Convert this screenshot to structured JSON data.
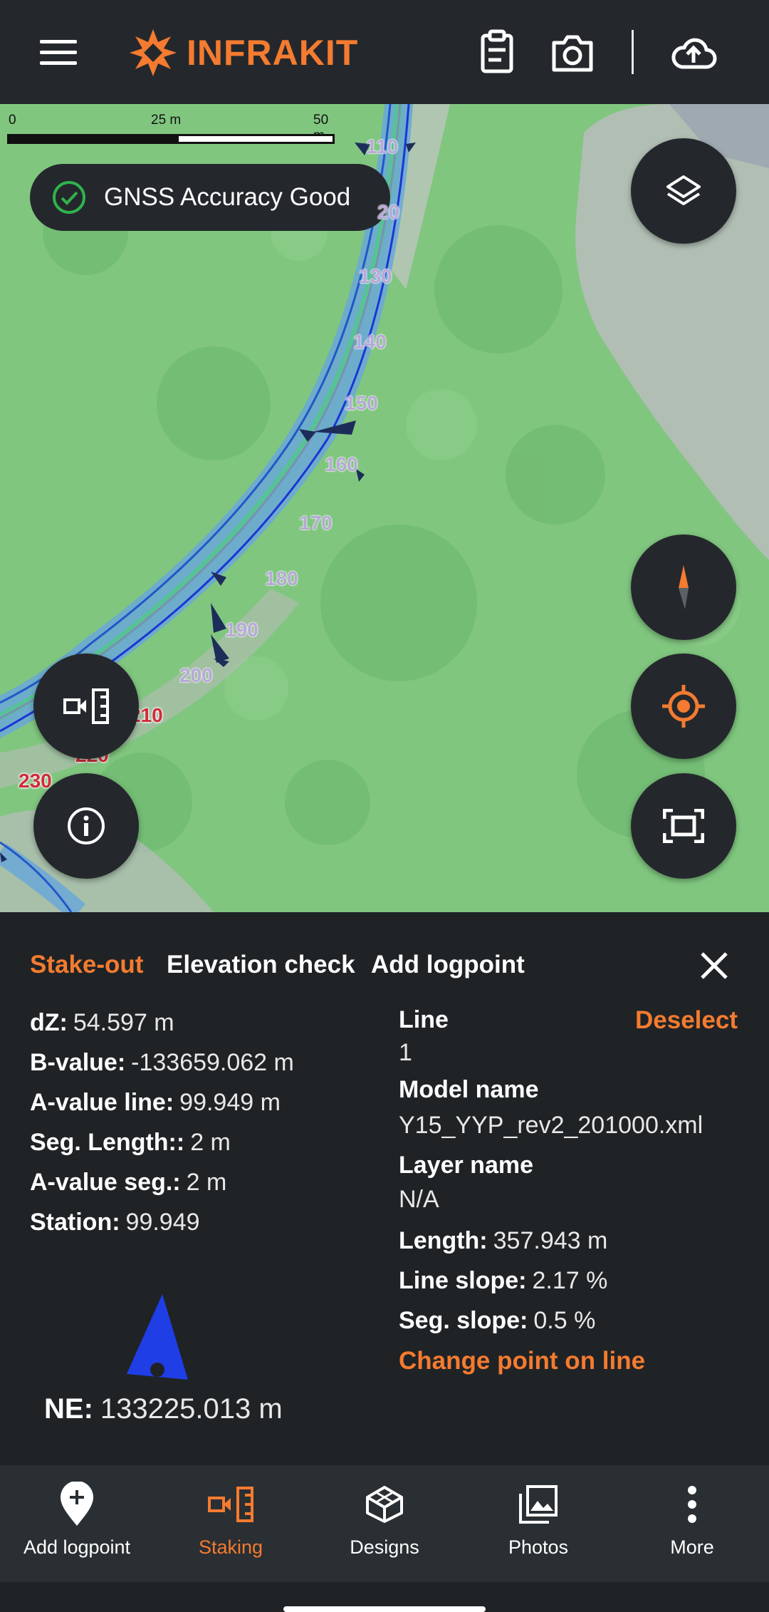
{
  "header": {
    "menu_icon": "hamburger-icon",
    "logo_text": "INFRAKIT",
    "icons": [
      "clipboard-icon",
      "camera-icon",
      "cloud-upload-icon"
    ],
    "brand_color": "#f47b30"
  },
  "map": {
    "scale": {
      "labels": [
        "0",
        "25 m",
        "50 m"
      ]
    },
    "gnss_status": "GNSS Accuracy Good",
    "station_labels": [
      "110",
      "20",
      "130",
      "140",
      "150",
      "160",
      "170",
      "180",
      "190",
      "200",
      "210",
      "220",
      "230"
    ],
    "buttons": {
      "layers": "layers-icon",
      "compass": "compass-icon",
      "locate": "crosshair-icon",
      "fit": "fit-screen-icon",
      "staking_mode": "staking-icon",
      "info": "info-icon"
    }
  },
  "sheet": {
    "tabs": [
      "Stake-out",
      "Elevation check",
      "Add logpoint"
    ],
    "active_tab": "Stake-out",
    "left": [
      {
        "key": "dZ:",
        "value": "54.597 m"
      },
      {
        "key": "B-value:",
        "value": "-133659.062 m"
      },
      {
        "key": "A-value line:",
        "value": "99.949 m"
      },
      {
        "key": "Seg. Length::",
        "value": "2 m"
      },
      {
        "key": "A-value seg.:",
        "value": "2 m"
      },
      {
        "key": "Station:",
        "value": "99.949"
      }
    ],
    "right": {
      "line_label": "Line",
      "line_value": "1",
      "deselect": "Deselect",
      "model_label": "Model name",
      "model_value": "Y15_YYP_rev2_201000.xml",
      "layer_label": "Layer name",
      "layer_value": "N/A",
      "length_key": "Length:",
      "length_value": "357.943 m",
      "line_slope_key": "Line slope:",
      "line_slope_value": "2.17 %",
      "seg_slope_key": "Seg. slope:",
      "seg_slope_value": "0.5 %",
      "change_point": "Change point on line"
    },
    "ne_key": "NE:",
    "ne_value": "133225.013 m"
  },
  "nav": {
    "items": [
      {
        "label": "Add logpoint",
        "icon": "add-logpoint-icon"
      },
      {
        "label": "Staking",
        "icon": "staking-icon"
      },
      {
        "label": "Designs",
        "icon": "designs-icon"
      },
      {
        "label": "Photos",
        "icon": "photos-icon"
      },
      {
        "label": "More",
        "icon": "more-vertical-icon"
      }
    ],
    "active": "Staking"
  }
}
